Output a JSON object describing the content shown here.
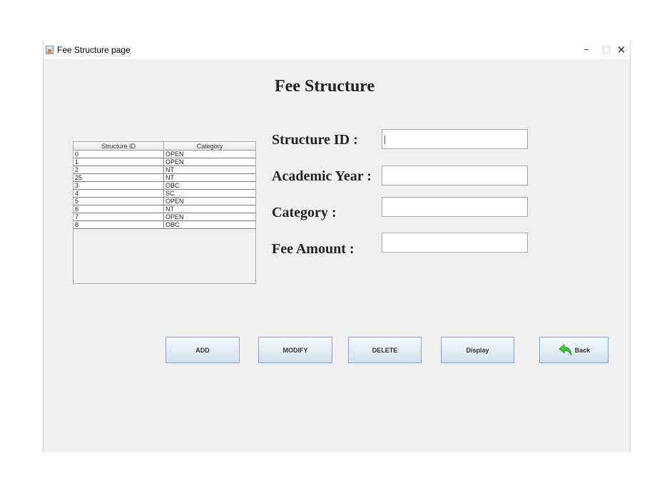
{
  "window": {
    "title": "Fee Structure page"
  },
  "header": {
    "title": "Fee Structure"
  },
  "table": {
    "columns": [
      "Structure ID",
      "Category"
    ],
    "rows": [
      [
        "0",
        "OPEN"
      ],
      [
        "1",
        "OPEN"
      ],
      [
        "2",
        "NT"
      ],
      [
        "25",
        "NT"
      ],
      [
        "3",
        "OBC"
      ],
      [
        "4",
        "SC"
      ],
      [
        "5",
        "OPEN"
      ],
      [
        "6",
        "NT"
      ],
      [
        "7",
        "OPEN"
      ],
      [
        "8",
        "OBC"
      ]
    ]
  },
  "form": {
    "structure_id": {
      "label": "Structure ID :",
      "value": ""
    },
    "academic_year": {
      "label": "Academic Year :",
      "value": ""
    },
    "category": {
      "label": "Category :",
      "value": ""
    },
    "fee_amount": {
      "label": "Fee Amount :",
      "value": ""
    }
  },
  "buttons": {
    "add": "ADD",
    "modify": "MODIFY",
    "delete": "DELETE",
    "display": "Display",
    "back": "Back"
  },
  "icons": {
    "back": "back-arrow-icon",
    "app": "java-app-icon"
  },
  "colors": {
    "back_arrow": "#3cc43c",
    "button_border": "#8fa4bf"
  }
}
